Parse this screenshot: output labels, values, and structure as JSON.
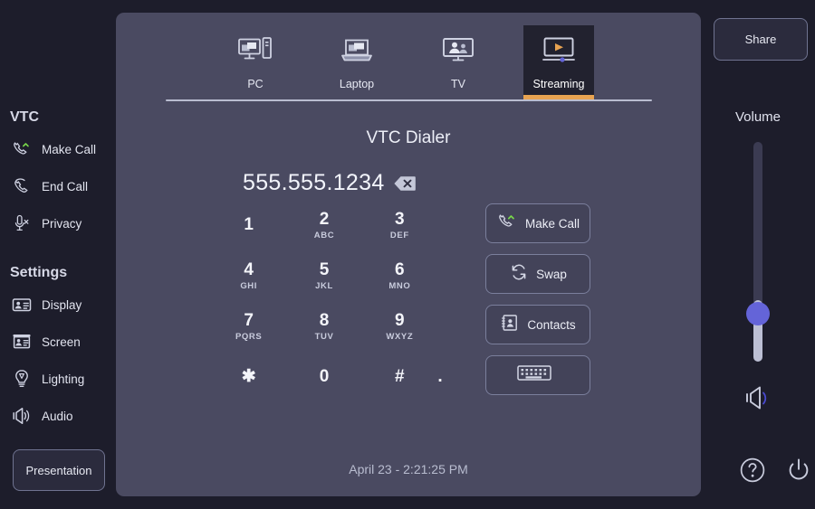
{
  "sidebar": {
    "groups": [
      {
        "title": "VTC",
        "items": [
          {
            "label": "Make Call",
            "icon": "phone-up-icon"
          },
          {
            "label": "End Call",
            "icon": "phone-down-icon"
          },
          {
            "label": "Privacy",
            "icon": "microphone-mute-icon"
          }
        ]
      },
      {
        "title": "Settings",
        "items": [
          {
            "label": "Display",
            "icon": "display-icon"
          },
          {
            "label": "Screen",
            "icon": "screen-icon"
          },
          {
            "label": "Lighting",
            "icon": "lightbulb-icon"
          },
          {
            "label": "Audio",
            "icon": "speaker-icon"
          }
        ]
      }
    ],
    "presentation_label": "Presentation"
  },
  "tabs": [
    {
      "label": "PC",
      "icon": "desktop-pc-icon",
      "active": false
    },
    {
      "label": "Laptop",
      "icon": "laptop-icon",
      "active": false
    },
    {
      "label": "TV",
      "icon": "tv-people-icon",
      "active": false
    },
    {
      "label": "Streaming",
      "icon": "streaming-play-icon",
      "active": true
    }
  ],
  "dialer": {
    "title": "VTC Dialer",
    "number": "555.555.1234",
    "backspace_icon": "backspace-icon",
    "keys": [
      {
        "digit": "1",
        "letters": ""
      },
      {
        "digit": "2",
        "letters": "ABC"
      },
      {
        "digit": "3",
        "letters": "DEF"
      },
      {
        "digit": "4",
        "letters": "GHI"
      },
      {
        "digit": "5",
        "letters": "JKL"
      },
      {
        "digit": "6",
        "letters": "MNO"
      },
      {
        "digit": "7",
        "letters": "PQRS"
      },
      {
        "digit": "8",
        "letters": "TUV"
      },
      {
        "digit": "9",
        "letters": "WXYZ"
      },
      {
        "digit": "✱",
        "letters": ""
      },
      {
        "digit": "0",
        "letters": ""
      },
      {
        "digit": "#",
        "letters": ""
      }
    ],
    "dot_key": ".",
    "actions": [
      {
        "label": "Make Call",
        "icon": "phone-up-icon"
      },
      {
        "label": "Swap",
        "icon": "swap-arrows-icon"
      },
      {
        "label": "Contacts",
        "icon": "contacts-book-icon"
      },
      {
        "label": "",
        "icon": "keyboard-icon"
      }
    ],
    "clock": "April 23 - 2:21:25 PM"
  },
  "right_panel": {
    "share_label": "Share",
    "volume_label": "Volume",
    "volume_icon": "speaker-icon",
    "help_icon": "help-circle-icon",
    "power_icon": "power-icon"
  },
  "colors": {
    "background": "#1d1d2b",
    "panel": "#4a4a61",
    "accent_orange": "#e8a351",
    "accent_blue": "#6464d8",
    "accent_green": "#79d94a",
    "tab_active_bg": "#22222f"
  }
}
